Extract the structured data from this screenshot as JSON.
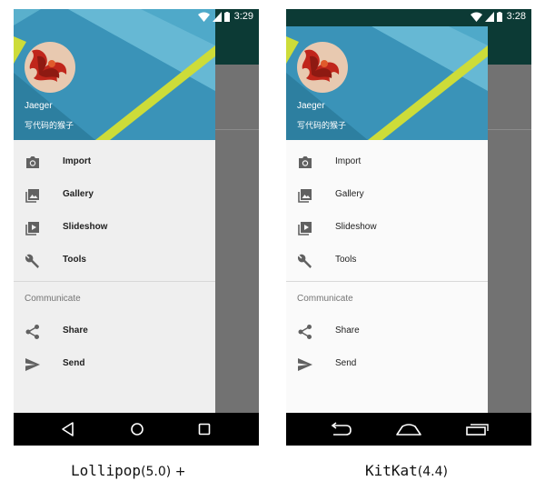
{
  "phones": [
    {
      "status_time": "3:29",
      "user_name": "Jaeger",
      "user_subtitle": "写代码的猴子",
      "menu": [
        {
          "label": "Import",
          "icon": "camera-icon"
        },
        {
          "label": "Gallery",
          "icon": "gallery-icon"
        },
        {
          "label": "Slideshow",
          "icon": "slideshow-icon"
        },
        {
          "label": "Tools",
          "icon": "wrench-icon"
        }
      ],
      "section_label": "Communicate",
      "communicate": [
        {
          "label": "Share",
          "icon": "share-icon"
        },
        {
          "label": "Send",
          "icon": "send-icon"
        }
      ],
      "caption_code": "Lollipop",
      "caption_version": "(5.0) +"
    },
    {
      "status_time": "3:28",
      "user_name": "Jaeger",
      "user_subtitle": "写代码的猴子",
      "menu": [
        {
          "label": "Import",
          "icon": "camera-icon"
        },
        {
          "label": "Gallery",
          "icon": "gallery-icon"
        },
        {
          "label": "Slideshow",
          "icon": "slideshow-icon"
        },
        {
          "label": "Tools",
          "icon": "wrench-icon"
        }
      ],
      "section_label": "Communicate",
      "communicate": [
        {
          "label": "Share",
          "icon": "share-icon"
        },
        {
          "label": "Send",
          "icon": "send-icon"
        }
      ],
      "caption_code": "KitKat",
      "caption_version": "(4.4)"
    }
  ],
  "colors": {
    "header_blue": "#3a93b8",
    "header_accent": "#cddc39",
    "app_bar": "#0c3a35",
    "scrim": "#727272",
    "nav_bar": "#000000"
  }
}
